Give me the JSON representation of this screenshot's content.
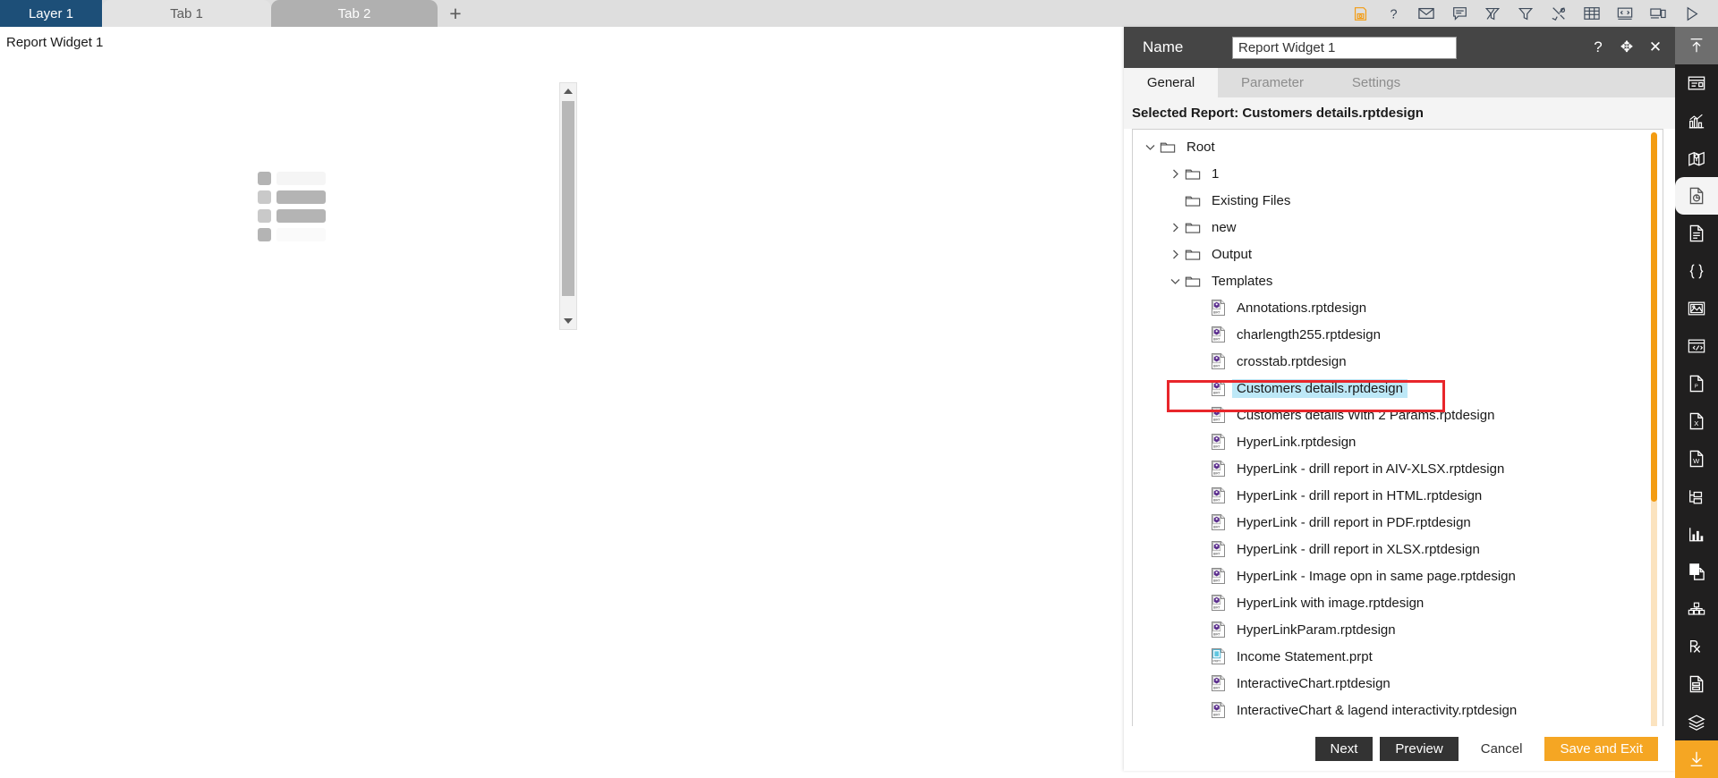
{
  "tabstrip": {
    "layer_tab": "Layer 1",
    "tab1": "Tab 1",
    "tab2": "Tab 2",
    "add_tab": "+",
    "icons": [
      {
        "name": "save-icon",
        "title": "Save"
      },
      {
        "name": "help-icon",
        "title": "Help"
      },
      {
        "name": "mail-icon",
        "title": "Mail"
      },
      {
        "name": "comment-icon",
        "title": "Comment"
      },
      {
        "name": "clear-filter-icon",
        "title": "Clear Filter"
      },
      {
        "name": "filter-icon",
        "title": "Filter"
      },
      {
        "name": "tools-icon",
        "title": "Tools"
      },
      {
        "name": "table-icon",
        "title": "Table"
      },
      {
        "name": "code-icon",
        "title": "Code"
      },
      {
        "name": "responsive-icon",
        "title": "Responsive"
      },
      {
        "name": "play-icon",
        "title": "Run"
      }
    ],
    "accent_selected": "#1d4f78"
  },
  "canvas": {
    "widget_label": "Report Widget 1"
  },
  "panel": {
    "name_label": "Name",
    "name_value": "Report Widget 1",
    "name_placeholder": "Report Widget 1",
    "header_icons": [
      {
        "name": "help-icon",
        "glyph": "?"
      },
      {
        "name": "move-icon",
        "glyph": "✥"
      },
      {
        "name": "close-icon",
        "glyph": "✕"
      }
    ],
    "tabs": [
      {
        "label": "General",
        "active": true
      },
      {
        "label": "Parameter",
        "active": false
      },
      {
        "label": "Settings",
        "active": false
      }
    ],
    "selected_report": "Selected Report: Customers details.rptdesign",
    "buttons": [
      {
        "label": "Next",
        "style": "dark"
      },
      {
        "label": "Preview",
        "style": "dark"
      },
      {
        "label": "Cancel",
        "style": "plain"
      },
      {
        "label": "Save and Exit",
        "style": "orange"
      }
    ],
    "accent_orange": "#f5a623",
    "selection_highlight": "#bde8f7",
    "annotation_color": "#e8262b"
  },
  "tree": {
    "nodes": [
      {
        "label": "Root",
        "depth": 0,
        "type": "folder",
        "expander": "down",
        "selected": false
      },
      {
        "label": "1",
        "depth": 1,
        "type": "folder",
        "expander": "right",
        "selected": false
      },
      {
        "label": "Existing Files",
        "depth": 1,
        "type": "folder",
        "expander": "none",
        "selected": false
      },
      {
        "label": "new",
        "depth": 1,
        "type": "folder",
        "expander": "right",
        "selected": false
      },
      {
        "label": "Output",
        "depth": 1,
        "type": "folder",
        "expander": "right",
        "selected": false
      },
      {
        "label": "Templates",
        "depth": 1,
        "type": "folder",
        "expander": "down",
        "selected": false
      },
      {
        "label": "Annotations.rptdesign",
        "depth": 2,
        "type": "rptdesign",
        "expander": "none",
        "selected": false
      },
      {
        "label": "charlength255.rptdesign",
        "depth": 2,
        "type": "rptdesign",
        "expander": "none",
        "selected": false
      },
      {
        "label": "crosstab.rptdesign",
        "depth": 2,
        "type": "rptdesign",
        "expander": "none",
        "selected": false
      },
      {
        "label": "Customers details.rptdesign",
        "depth": 2,
        "type": "rptdesign",
        "expander": "none",
        "selected": true
      },
      {
        "label": "Customers details With 2 Params.rptdesign",
        "depth": 2,
        "type": "rptdesign",
        "expander": "none",
        "selected": false
      },
      {
        "label": "HyperLink.rptdesign",
        "depth": 2,
        "type": "rptdesign",
        "expander": "none",
        "selected": false
      },
      {
        "label": "HyperLink - drill report in AIV-XLSX.rptdesign",
        "depth": 2,
        "type": "rptdesign",
        "expander": "none",
        "selected": false
      },
      {
        "label": "HyperLink - drill report in HTML.rptdesign",
        "depth": 2,
        "type": "rptdesign",
        "expander": "none",
        "selected": false
      },
      {
        "label": "HyperLink - drill report in PDF.rptdesign",
        "depth": 2,
        "type": "rptdesign",
        "expander": "none",
        "selected": false
      },
      {
        "label": "HyperLink - drill report in XLSX.rptdesign",
        "depth": 2,
        "type": "rptdesign",
        "expander": "none",
        "selected": false
      },
      {
        "label": "HyperLink - Image opn in same page.rptdesign",
        "depth": 2,
        "type": "rptdesign",
        "expander": "none",
        "selected": false
      },
      {
        "label": "HyperLink with image.rptdesign",
        "depth": 2,
        "type": "rptdesign",
        "expander": "none",
        "selected": false
      },
      {
        "label": "HyperLinkParam.rptdesign",
        "depth": 2,
        "type": "rptdesign",
        "expander": "none",
        "selected": false
      },
      {
        "label": "Income Statement.prpt",
        "depth": 2,
        "type": "prpt",
        "expander": "none",
        "selected": false
      },
      {
        "label": "InteractiveChart.rptdesign",
        "depth": 2,
        "type": "rptdesign",
        "expander": "none",
        "selected": false
      },
      {
        "label": "InteractiveChart & lagend interactivity.rptdesign",
        "depth": 2,
        "type": "rptdesign",
        "expander": "none",
        "selected": false
      }
    ]
  },
  "vbar": {
    "items": [
      {
        "name": "collapse-up-icon",
        "state": "top"
      },
      {
        "name": "widget-icon",
        "state": "normal"
      },
      {
        "name": "chart-icon",
        "state": "normal"
      },
      {
        "name": "map-icon",
        "state": "normal"
      },
      {
        "name": "report-icon",
        "state": "active"
      },
      {
        "name": "document-icon",
        "state": "normal"
      },
      {
        "name": "json-icon",
        "state": "normal"
      },
      {
        "name": "image-icon",
        "state": "normal"
      },
      {
        "name": "embed-icon",
        "state": "normal"
      },
      {
        "name": "pdf-icon",
        "state": "normal"
      },
      {
        "name": "excel-icon",
        "state": "normal"
      },
      {
        "name": "word-icon",
        "state": "normal"
      },
      {
        "name": "tree-icon",
        "state": "normal"
      },
      {
        "name": "bar-chart-icon",
        "state": "normal"
      },
      {
        "name": "copy-page-icon",
        "state": "normal"
      },
      {
        "name": "cluster-icon",
        "state": "normal"
      },
      {
        "name": "prescription-icon",
        "state": "normal"
      },
      {
        "name": "form-icon",
        "state": "normal"
      },
      {
        "name": "layers-icon",
        "state": "normal"
      },
      {
        "name": "download-icon",
        "state": "download"
      }
    ]
  }
}
